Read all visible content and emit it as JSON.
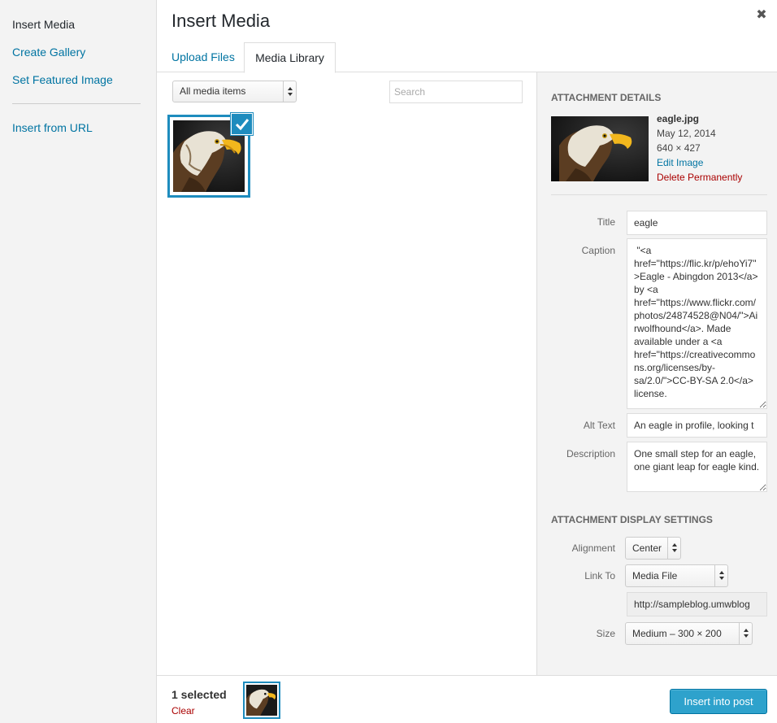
{
  "menu": {
    "insert_media": "Insert Media",
    "create_gallery": "Create Gallery",
    "set_featured": "Set Featured Image",
    "insert_url": "Insert from URL"
  },
  "header": {
    "title": "Insert Media",
    "close_glyph": "✖",
    "close_icon": "close-icon"
  },
  "tabs": [
    {
      "label": "Upload Files",
      "active": false
    },
    {
      "label": "Media Library",
      "active": true
    }
  ],
  "toolbar": {
    "filter_value": "All media items",
    "search_placeholder": "Search"
  },
  "library": {
    "items": [
      {
        "name": "eagle",
        "selected": true,
        "thumbnail_icon": "eagle-photo"
      }
    ]
  },
  "details": {
    "section_title": "Attachment Details",
    "filename": "eagle.jpg",
    "date": "May 12, 2014",
    "dimensions": "640 × 427",
    "edit_link": "Edit Image",
    "delete_link": "Delete Permanently",
    "title_label": "Title",
    "title_value": "eagle",
    "caption_label": "Caption",
    "caption_value": " \"<a href=\"https://flic.kr/p/ehoYi7\">Eagle - Abingdon 2013</a> by <a href=\"https://www.flickr.com/photos/24874528@N04/\">Airwolfhound</a>. Made available under a <a href=\"https://creativecommons.org/licenses/by-sa/2.0/\">CC-BY-SA 2.0</a> license.",
    "alt_label": "Alt Text",
    "alt_value": "An eagle in profile, looking t",
    "description_label": "Description",
    "description_value": "One small step for an eagle, one giant leap for eagle kind."
  },
  "display": {
    "section_title": "Attachment Display Settings",
    "alignment_label": "Alignment",
    "alignment_value": "Center",
    "link_label": "Link To",
    "link_value": "Media File",
    "link_url": "http://sampleblog.umwblog",
    "size_label": "Size",
    "size_value": "Medium – 300 × 200"
  },
  "footer": {
    "selected_count": "1 selected",
    "clear": "Clear",
    "insert_button": "Insert into post"
  },
  "colors": {
    "accent": "#1e8cbe",
    "link": "#0074a2",
    "danger": "#a00",
    "primary_button": "#2ea2cc"
  }
}
